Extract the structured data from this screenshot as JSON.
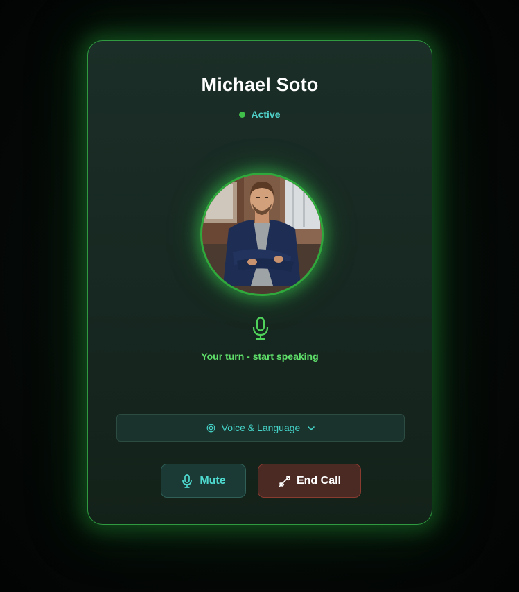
{
  "contact": {
    "name": "Michael Soto",
    "status": "Active",
    "avatar_icon": "person-photo"
  },
  "prompt": {
    "turn_text": "Your turn - start speaking",
    "icon": "microphone-icon"
  },
  "settings": {
    "voice_language_label": "Voice & Language",
    "icon": "gear-icon"
  },
  "controls": {
    "mute_label": "Mute",
    "end_call_label": "End Call"
  },
  "colors": {
    "accent_green": "#3fbf4a",
    "teal_text": "#4fd0c8",
    "end_call_bg": "#4a2a23"
  }
}
